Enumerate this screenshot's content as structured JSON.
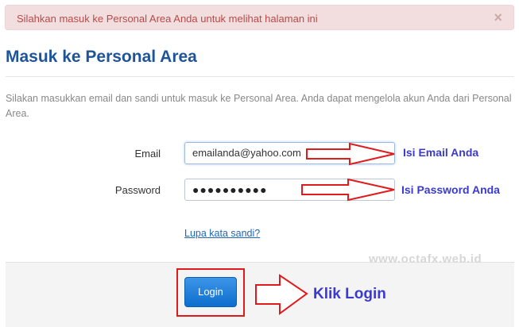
{
  "alert": {
    "message": "Silahkan masuk ke Personal Area Anda untuk melihat halaman ini",
    "close_glyph": "×"
  },
  "page": {
    "title": "Masuk ke Personal Area",
    "intro": "Silakan masukkan email dan sandi untuk masuk ke Personal Area. Anda dapat mengelola akun Anda dari Personal Area."
  },
  "form": {
    "email_label": "Email",
    "email_value": "emailanda@yahoo.com",
    "password_label": "Password",
    "password_value": "●●●●●●●●●●",
    "forgot_link": "Lupa kata sandi?",
    "login_label": "Login"
  },
  "annotations": {
    "email_hint": "Isi Email Anda",
    "password_hint": "Isi Password Anda",
    "login_hint": "Klik Login",
    "watermark": "www.octafx.web.id"
  },
  "colors": {
    "alert_bg": "#f2dede",
    "alert_text": "#b94a48",
    "title": "#1f5498",
    "button": "#1a7ad9",
    "annotation_red": "#e01b1b",
    "annotation_blue": "#3a3ad0"
  }
}
